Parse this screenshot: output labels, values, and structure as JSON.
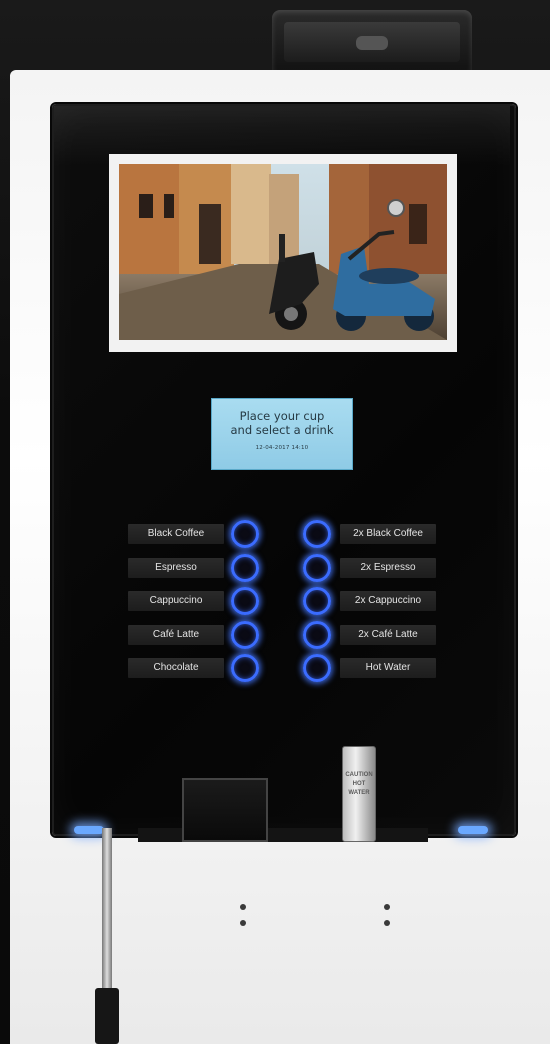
{
  "display": {
    "line1": "Place your cup",
    "line2": "and select a drink",
    "datetime": "12-04-2017 14:10"
  },
  "drinks": {
    "left": [
      "Black Coffee",
      "Espresso",
      "Cappuccino",
      "Café Latte",
      "Chocolate"
    ],
    "right": [
      "2x Black Coffee",
      "2x Espresso",
      "2x Cappuccino",
      "2x Café Latte",
      "Hot Water"
    ]
  },
  "hot_water_sign": {
    "text": "CAUTION HOT WATER"
  },
  "colors": {
    "button_ring": "#3b6cff",
    "lcd_background": "#a9dcf0",
    "panel": "#050505"
  }
}
